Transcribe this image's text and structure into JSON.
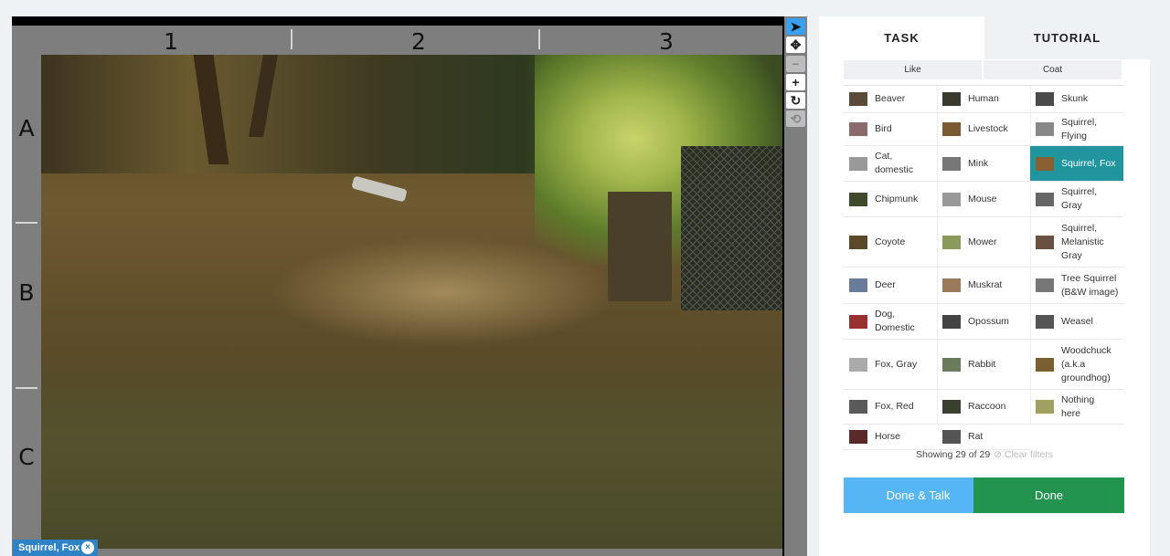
{
  "viewer": {
    "columns": [
      "1",
      "2",
      "3"
    ],
    "rows": [
      "A",
      "B",
      "C"
    ],
    "tools": [
      {
        "icon": "pointer-icon",
        "glyph": "➤"
      },
      {
        "icon": "move-icon",
        "glyph": "✥"
      },
      {
        "icon": "zoom-out-icon",
        "glyph": "−"
      },
      {
        "icon": "zoom-in-icon",
        "glyph": "+"
      },
      {
        "icon": "rotate-icon",
        "glyph": "↻"
      },
      {
        "icon": "reset-icon",
        "glyph": "⟲"
      }
    ],
    "tag": {
      "label": "Squirrel, Fox",
      "remove": "×"
    }
  },
  "tabs": {
    "task": "TASK",
    "tutorial": "TUTORIAL"
  },
  "filters": {
    "like": "Like",
    "coat": "Coat"
  },
  "choices": [
    {
      "label": "Beaver",
      "thumb": "#5a4a3a"
    },
    {
      "label": "Human",
      "thumb": "#3c3a30"
    },
    {
      "label": "Skunk",
      "thumb": "#4a4a4a"
    },
    {
      "label": "Bird",
      "thumb": "#8a6a6a"
    },
    {
      "label": "Livestock",
      "thumb": "#7a5a30"
    },
    {
      "label": "Squirrel,\nFlying",
      "thumb": "#888888"
    },
    {
      "label": "Cat,\ndomestic",
      "thumb": "#999999"
    },
    {
      "label": "Mink",
      "thumb": "#777777"
    },
    {
      "label": "Squirrel, Fox",
      "thumb": "#8a6030",
      "selected": true
    },
    {
      "label": "Chipmunk",
      "thumb": "#3e4a2a"
    },
    {
      "label": "Mouse",
      "thumb": "#999999"
    },
    {
      "label": "Squirrel,\nGray",
      "thumb": "#666666"
    },
    {
      "label": "Coyote",
      "thumb": "#5a4a2a"
    },
    {
      "label": "Mower",
      "thumb": "#8a9a5a"
    },
    {
      "label": "Squirrel,\nMelanistic\nGray",
      "thumb": "#6a5040"
    },
    {
      "label": "Deer",
      "thumb": "#6a7a9a"
    },
    {
      "label": "Muskrat",
      "thumb": "#9a7a5a"
    },
    {
      "label": "Tree Squirrel\n(B&W image)",
      "thumb": "#777777"
    },
    {
      "label": "Dog,\nDomestic",
      "thumb": "#9a3030"
    },
    {
      "label": "Opossum",
      "thumb": "#444444"
    },
    {
      "label": "Weasel",
      "thumb": "#555555"
    },
    {
      "label": "Fox, Gray",
      "thumb": "#aaaaaa"
    },
    {
      "label": "Rabbit",
      "thumb": "#6a7a5a"
    },
    {
      "label": "Woodchuck\n(a.k.a\ngroundhog)",
      "thumb": "#7a6030"
    },
    {
      "label": "Fox, Red",
      "thumb": "#5a5a5a"
    },
    {
      "label": "Raccoon",
      "thumb": "#3a4030"
    },
    {
      "label": "Nothing\nhere",
      "thumb": "#a0a060"
    },
    {
      "label": "Horse",
      "thumb": "#5a2a2a"
    },
    {
      "label": "Rat",
      "thumb": "#555555"
    }
  ],
  "showing": {
    "text": "Showing 29 of 29",
    "clear": "⊘ Clear filters"
  },
  "buttons": {
    "talk": "Done & Talk",
    "done": "Done"
  }
}
